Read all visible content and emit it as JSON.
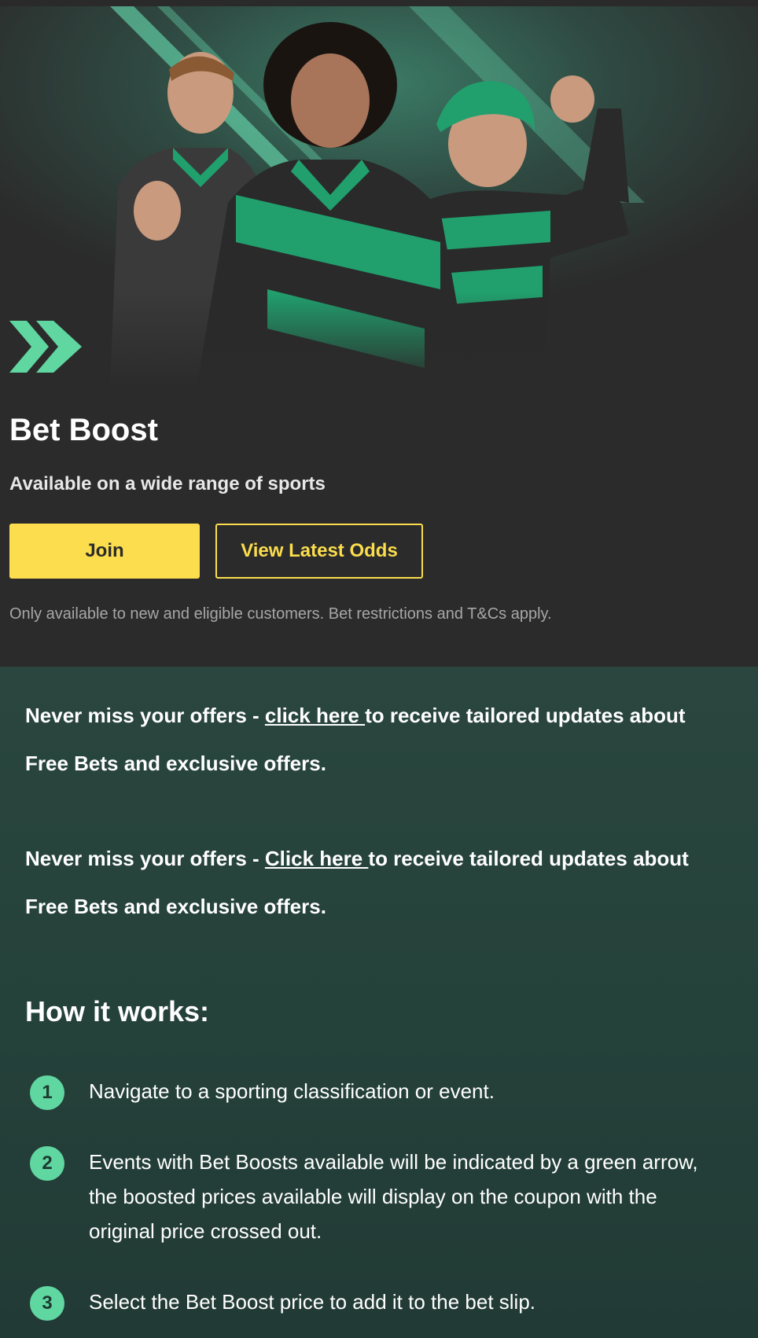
{
  "hero": {
    "title": "Bet Boost",
    "subtitle": "Available on a wide range of sports",
    "join_label": "Join",
    "odds_label": "View Latest Odds",
    "disclaimer": "Only available to new and eligible customers. Bet restrictions and T&Cs apply."
  },
  "offers": [
    {
      "prefix": "Never miss your offers - ",
      "link": "click here ",
      "suffix": "to receive tailored updates about Free Bets and exclusive offers."
    },
    {
      "prefix": "Never miss your offers - ",
      "link": "Click here ",
      "suffix": "to receive tailored updates about Free Bets and exclusive offers."
    }
  ],
  "how": {
    "title": "How it works:",
    "steps": [
      {
        "num": "1",
        "text": "Navigate to a sporting classification or event."
      },
      {
        "num": "2",
        "text": "Events with Bet Boosts available will be indicated by a green arrow, the boosted prices available will display on the coupon with the original price crossed out."
      },
      {
        "num": "3",
        "text": "Select the Bet Boost price to add it to the bet slip."
      }
    ]
  },
  "colors": {
    "accent_yellow": "#fbdd4d",
    "brand_green": "#60d6a0",
    "hero_bg": "#2b2b2b",
    "content_bg": "#263f39"
  },
  "icons": {
    "hero": "bet-boost-chevron-icon"
  }
}
